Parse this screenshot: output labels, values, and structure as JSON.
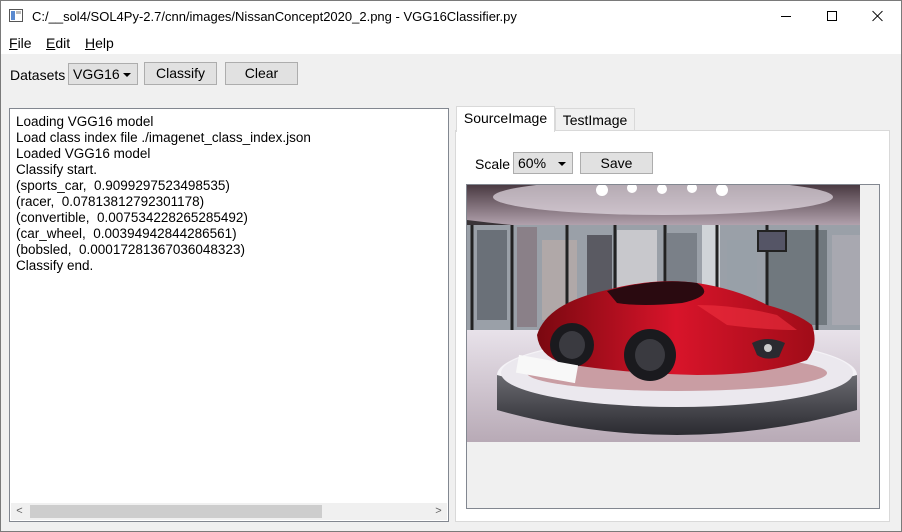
{
  "window": {
    "title": "C:/__sol4/SOL4Py-2.7/cnn/images/NissanConcept2020_2.png - VGG16Classifier.py",
    "controls": {
      "minimize": "—",
      "maximize": "☐",
      "close": "✕"
    }
  },
  "menu": {
    "items": [
      {
        "label": "File",
        "mnemonic": "F",
        "rest": "ile"
      },
      {
        "label": "Edit",
        "mnemonic": "E",
        "rest": "dit"
      },
      {
        "label": "Help",
        "mnemonic": "H",
        "rest": "elp"
      }
    ]
  },
  "toolbar": {
    "datasets_label": "Datasets",
    "datasets_value": "VGG16",
    "classify_label": "Classify",
    "clear_label": "Clear"
  },
  "log": {
    "lines": [
      "Loading VGG16 model",
      "Load class index file ./imagenet_class_index.json",
      "Loaded VGG16 model",
      "Classify start.",
      "(sports_car,  0.9099297523498535)",
      "(racer,  0.07813812792301178)",
      "(convertible,  0.007534228265285492)",
      "(car_wheel,  0.00394942844286561)",
      "(bobsled,  0.00017281367036048323)",
      "Classify end."
    ],
    "scroll_left": "<",
    "scroll_right": ">"
  },
  "tabs": [
    {
      "label": "SourceImage",
      "active": true
    },
    {
      "label": "TestImage",
      "active": false
    }
  ],
  "image_panel": {
    "scale_label": "Scale",
    "scale_value": "60%",
    "save_label": "Save",
    "image_description_icon": "car-photo",
    "colors": {
      "car_red": "#c8101e",
      "floor_white": "#e6e0e6",
      "ceiling": "#d0c8d0"
    }
  }
}
